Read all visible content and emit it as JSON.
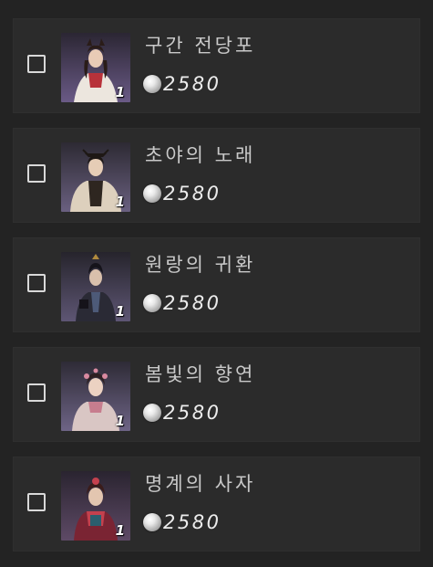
{
  "currency_icon": "pearl-icon",
  "items": [
    {
      "name": "구간 전당포",
      "price": "2580",
      "quantity": "1",
      "checked": false,
      "colors": {
        "bg": "#3b3047",
        "body": "#e8e0d8",
        "accent": "#b8323a",
        "hair": "#2a1c18"
      }
    },
    {
      "name": "초야의 노래",
      "price": "2580",
      "quantity": "1",
      "checked": false,
      "colors": {
        "bg": "#3a3542",
        "body": "#d8c8b4",
        "accent": "#2e2620",
        "hair": "#1e1815"
      }
    },
    {
      "name": "원랑의 귀환",
      "price": "2580",
      "quantity": "1",
      "checked": false,
      "colors": {
        "bg": "#34323f",
        "body": "#2a2a35",
        "accent": "#4d5a78",
        "hair": "#15131a"
      }
    },
    {
      "name": "봄빛의 향연",
      "price": "2580",
      "quantity": "1",
      "checked": false,
      "colors": {
        "bg": "#3e3a4a",
        "body": "#d9c6c4",
        "accent": "#c77d8e",
        "hair": "#2e2022"
      }
    },
    {
      "name": "명계의 사자",
      "price": "2580",
      "quantity": "1",
      "checked": false,
      "colors": {
        "bg": "#3a2f3e",
        "body": "#7a2433",
        "accent": "#c4414e",
        "hair": "#3a1c1a"
      }
    }
  ]
}
